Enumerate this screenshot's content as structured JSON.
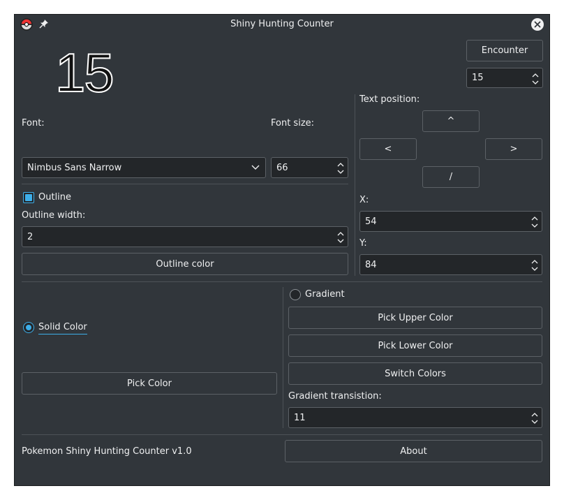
{
  "window": {
    "title": "Shiny Hunting Counter"
  },
  "preview": {
    "count": "15",
    "fill_color": "#111111",
    "outline_color": "#ffffff"
  },
  "encounter": {
    "button_label": "Encounter",
    "count_value": "15"
  },
  "font": {
    "label": "Font:",
    "value": "Nimbus Sans Narrow"
  },
  "font_size": {
    "label": "Font size:",
    "value": "66"
  },
  "text_position": {
    "label": "Text position:",
    "up": "^",
    "left": "<",
    "right": ">",
    "down": "/",
    "x_label": "X:",
    "x_value": "54",
    "y_label": "Y:",
    "y_value": "84"
  },
  "outline": {
    "checkbox_label": "Outline",
    "checked": true,
    "width_label": "Outline width:",
    "width_value": "2",
    "color_button": "Outline color"
  },
  "solid": {
    "radio_label": "Solid Color",
    "selected": true,
    "pick_button": "Pick Color"
  },
  "gradient": {
    "radio_label": "Gradient",
    "selected": false,
    "upper_button": "Pick Upper Color",
    "lower_button": "Pick Lower Color",
    "switch_button": "Switch Colors",
    "transition_label": "Gradient transistion:",
    "transition_value": "11"
  },
  "footer": {
    "version": "Pokemon Shiny Hunting Counter v1.0",
    "about_button": "About"
  },
  "colors": {
    "window_bg": "#31363b",
    "field_bg": "#232629",
    "accent": "#3daee9",
    "border": "#5c6166"
  },
  "icons": {
    "app": "pokeball-icon",
    "pin": "pin-icon",
    "close": "close-icon",
    "combo": "chevron-down-icon",
    "spin": "spin-arrows-icon"
  }
}
